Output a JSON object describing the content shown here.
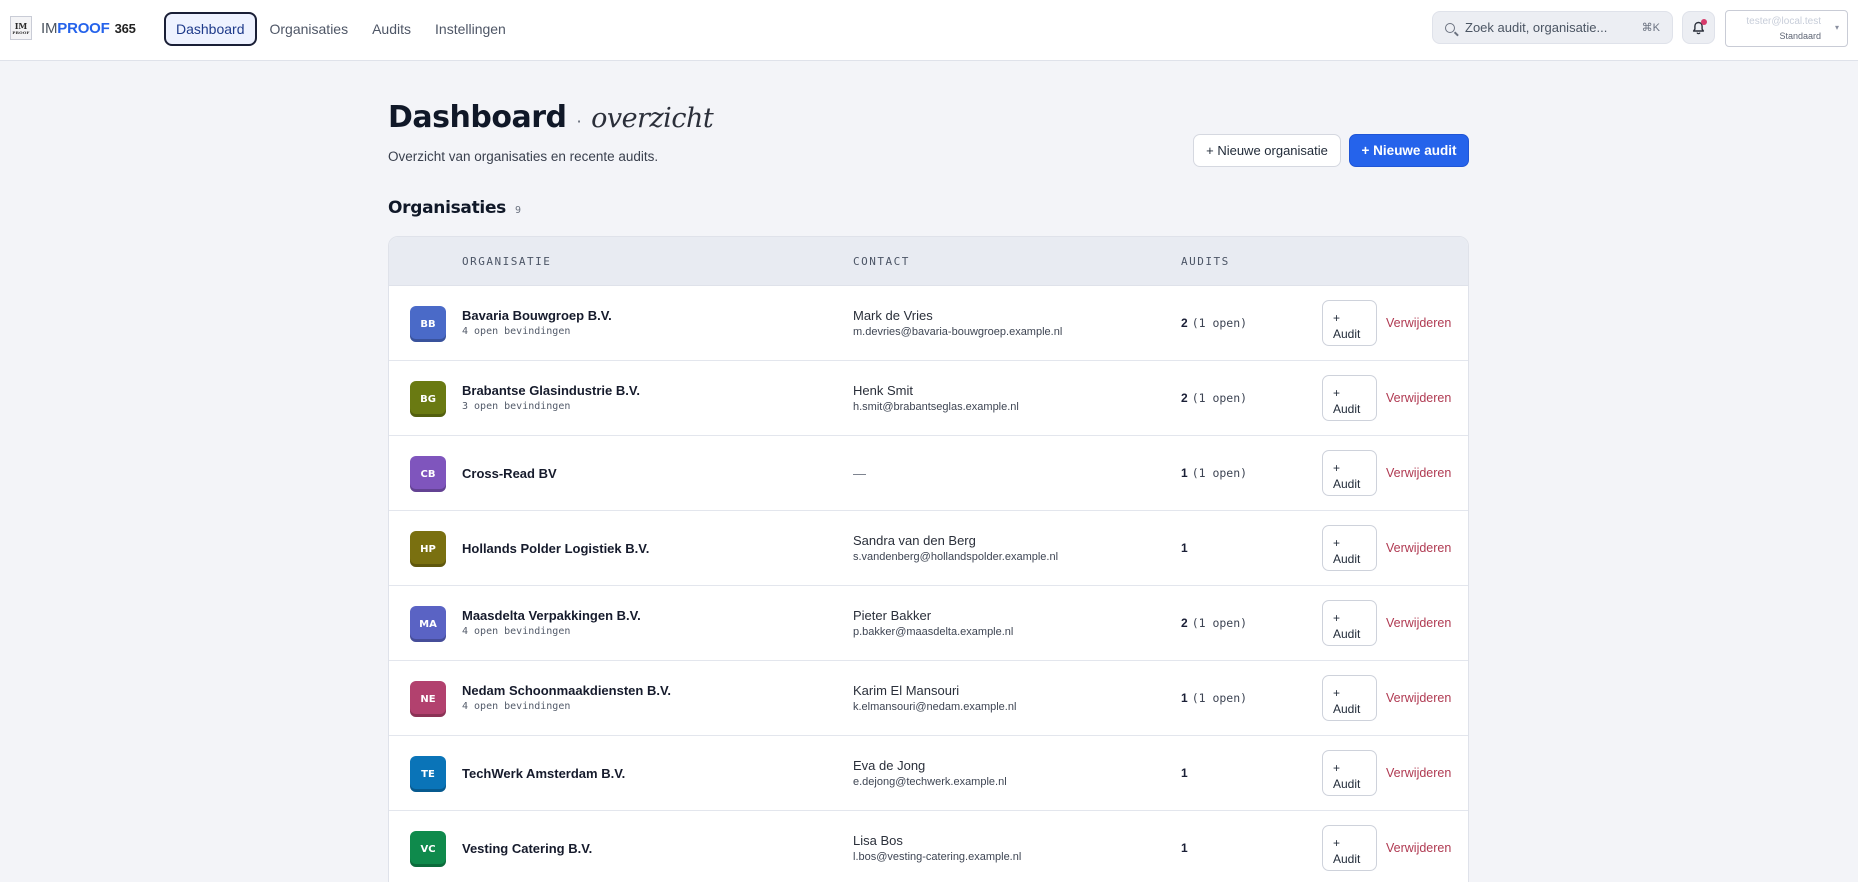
{
  "brand": {
    "mark_top": "IM",
    "mark_bottom": "PROOF",
    "name_light": "IM",
    "name_bold": "PROOF",
    "name_num": "365"
  },
  "nav": {
    "items": [
      {
        "label": "Dashboard",
        "active": true
      },
      {
        "label": "Organisaties",
        "active": false
      },
      {
        "label": "Audits",
        "active": false
      },
      {
        "label": "Instellingen",
        "active": false
      }
    ]
  },
  "search": {
    "placeholder": "Zoek audit, organisatie...",
    "shortcut": "⌘K",
    "icon": "search-icon"
  },
  "notifications": {
    "icon": "bell-icon",
    "has_unread": true
  },
  "user": {
    "email": "tester@local.test",
    "role": "Standaard"
  },
  "page": {
    "title": "Dashboard",
    "title_dot": "·",
    "title_sub": "overzicht",
    "subtitle": "Overzicht van organisaties en recente audits.",
    "new_org_label": "+ Nieuwe organisatie",
    "new_audit_label": "+ Nieuwe audit"
  },
  "organisations": {
    "title": "Organisaties",
    "count": "9",
    "columns": [
      "ORGANISATIE",
      "CONTACT",
      "AUDITS"
    ],
    "add_audit_label": [
      "+",
      "Audit"
    ],
    "delete_label": "Verwijderen",
    "rows": [
      {
        "initials": "BB",
        "color": "#4a6ac8",
        "name": "Bavaria Bouwgroep B.V.",
        "findings": "4 open bevindingen",
        "contact_name": "Mark de Vries",
        "contact_email": "m.devries@bavaria-bouwgroep.example.nl",
        "audits": "2",
        "open": "(1 open)"
      },
      {
        "initials": "BG",
        "color": "#6a7a12",
        "name": "Brabantse Glasindustrie B.V.",
        "findings": "3 open bevindingen",
        "contact_name": "Henk Smit",
        "contact_email": "h.smit@brabantseglas.example.nl",
        "audits": "2",
        "open": "(1 open)"
      },
      {
        "initials": "CB",
        "color": "#7f55bd",
        "name": "Cross-Read BV",
        "findings": "",
        "contact_name": "",
        "contact_email": "",
        "contact_empty": "—",
        "audits": "1",
        "open": "(1 open)"
      },
      {
        "initials": "HP",
        "color": "#7a7010",
        "name": "Hollands Polder Logistiek B.V.",
        "findings": "",
        "contact_name": "Sandra van den Berg",
        "contact_email": "s.vandenberg@hollandspolder.example.nl",
        "audits": "1",
        "open": ""
      },
      {
        "initials": "MA",
        "color": "#5a63c4",
        "name": "Maasdelta Verpakkingen B.V.",
        "findings": "4 open bevindingen",
        "contact_name": "Pieter Bakker",
        "contact_email": "p.bakker@maasdelta.example.nl",
        "audits": "2",
        "open": "(1 open)"
      },
      {
        "initials": "NE",
        "color": "#b2416e",
        "name": "Nedam Schoonmaakdiensten B.V.",
        "findings": "4 open bevindingen",
        "contact_name": "Karim El Mansouri",
        "contact_email": "k.elmansouri@nedam.example.nl",
        "audits": "1",
        "open": "(1 open)"
      },
      {
        "initials": "TE",
        "color": "#0a74b8",
        "name": "TechWerk Amsterdam B.V.",
        "findings": "",
        "contact_name": "Eva de Jong",
        "contact_email": "e.dejong@techwerk.example.nl",
        "audits": "1",
        "open": ""
      },
      {
        "initials": "VC",
        "color": "#0f8a4c",
        "name": "Vesting Catering B.V.",
        "findings": "",
        "contact_name": "Lisa Bos",
        "contact_email": "l.bos@vesting-catering.example.nl",
        "audits": "1",
        "open": ""
      }
    ]
  }
}
